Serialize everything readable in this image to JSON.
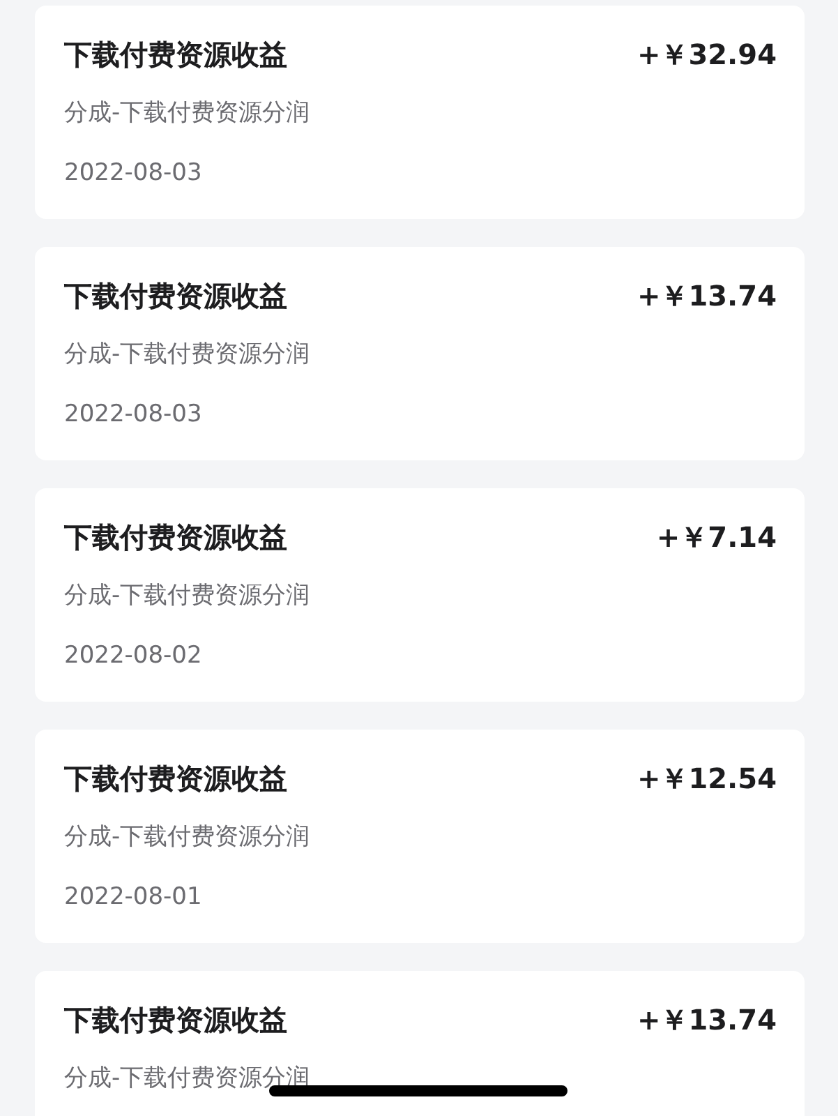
{
  "records": [
    {
      "title": "下载付费资源收益",
      "amount": "+￥32.94",
      "subtitle": "分成-下载付费资源分润",
      "date": "2022-08-03"
    },
    {
      "title": "下载付费资源收益",
      "amount": "+￥13.74",
      "subtitle": "分成-下载付费资源分润",
      "date": "2022-08-03"
    },
    {
      "title": "下载付费资源收益",
      "amount": "+￥7.14",
      "subtitle": "分成-下载付费资源分润",
      "date": "2022-08-02"
    },
    {
      "title": "下载付费资源收益",
      "amount": "+￥12.54",
      "subtitle": "分成-下载付费资源分润",
      "date": "2022-08-01"
    },
    {
      "title": "下载付费资源收益",
      "amount": "+￥13.74",
      "subtitle": "分成-下载付费资源分润"
    }
  ],
  "home_indicator": {
    "kind": "bar"
  }
}
